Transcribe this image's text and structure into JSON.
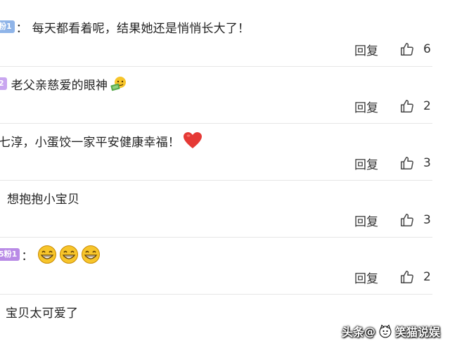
{
  "comments": [
    {
      "badge": "粉1",
      "badge_color": "#8fb4e8",
      "show_colon": true,
      "colon": "：",
      "text": "每天都看着呢，结果她还是悄悄长大了！",
      "emoji": "",
      "reply_label": "回复",
      "like_count": "6"
    },
    {
      "badge": "2",
      "badge_color": "#c9a6f0",
      "show_colon": false,
      "colon": "：",
      "text": "老父亲慈爱的眼神",
      "emoji": "money-face-emoji",
      "reply_label": "回复",
      "like_count": "2"
    },
    {
      "badge": "",
      "badge_color": "",
      "show_colon": false,
      "colon": "",
      "text": "七淳，小蛋饺一家平安健康幸福！",
      "emoji": "red-heart-emoji",
      "reply_label": "回复",
      "like_count": "3"
    },
    {
      "badge": "",
      "badge_color": "",
      "show_colon": false,
      "colon": "",
      "text": "想抱抱小宝贝",
      "emoji": "",
      "reply_label": "回复",
      "like_count": "3"
    },
    {
      "badge": "5粉1",
      "badge_color": "#b98be6",
      "show_colon": true,
      "colon": "：",
      "text": "",
      "emoji": "grinning-face-emoji-x3",
      "reply_label": "回复",
      "like_count": "2"
    },
    {
      "badge": "",
      "badge_color": "",
      "show_colon": false,
      "colon": "",
      "text": "宝贝太可爱了",
      "emoji": "",
      "reply_label": "",
      "like_count": ""
    }
  ],
  "watermark": {
    "source": "头条",
    "separator": "@",
    "author": "笑猫说娱"
  },
  "colors": {
    "text": "#222222",
    "divider": "#e6e6e6",
    "heart": "#e53935",
    "emoji_yellow": "#f7c52b"
  }
}
